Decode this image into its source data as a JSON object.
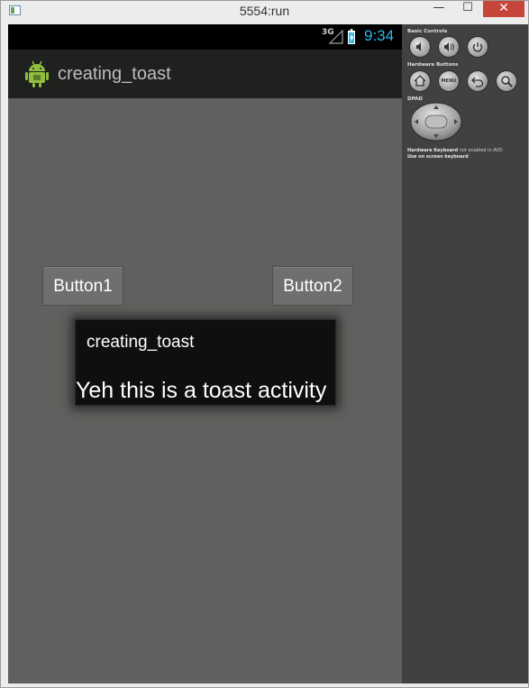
{
  "window": {
    "title": "5554:run",
    "minimize_glyph": "—",
    "maximize_glyph": "☐",
    "close_glyph": "✕"
  },
  "statusbar": {
    "network": "3G",
    "time": "9:34"
  },
  "actionbar": {
    "title": "creating_toast"
  },
  "buttons": {
    "button1": "Button1",
    "button2": "Button2"
  },
  "toast": {
    "title": "creating_toast",
    "message": "Yeh this is a toast activity"
  },
  "controls": {
    "basic_label": "Basic Controls",
    "hardware_label": "Hardware Buttons",
    "dpad_label": "DPAD",
    "menu_label": "MENU",
    "keyboard_bold": "Hardware Keyboard",
    "keyboard_rest": " not enabled in AVD",
    "keyboard_line2": "Use on screen keyboard"
  },
  "colors": {
    "clock": "#33b5e5",
    "close_button": "#c7463b",
    "screen_background": "#5f615e"
  }
}
